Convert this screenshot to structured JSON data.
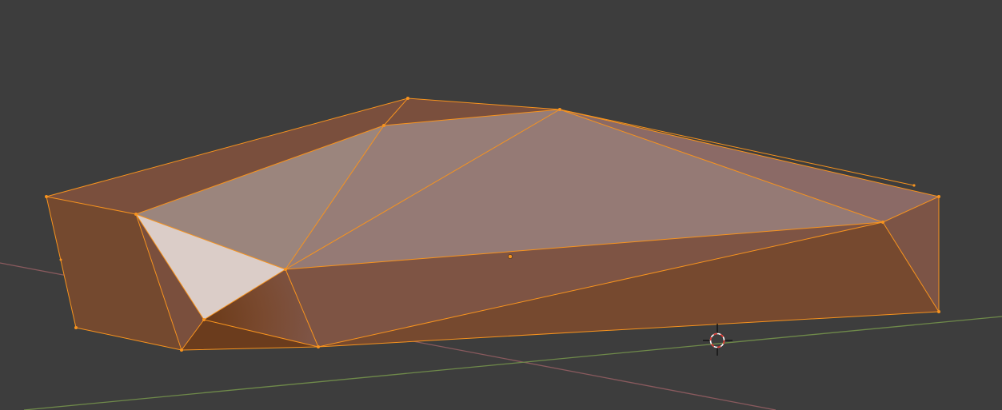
{
  "viewport": {
    "background": "#3d3d3d",
    "selection_color": "#f7931e",
    "x_axis_color": "#8a5a5e",
    "y_axis_color": "#6f8a4a",
    "mesh_selected": true,
    "mode": "edit",
    "icons": [
      "3d-cursor-icon",
      "object-origin-icon"
    ]
  }
}
